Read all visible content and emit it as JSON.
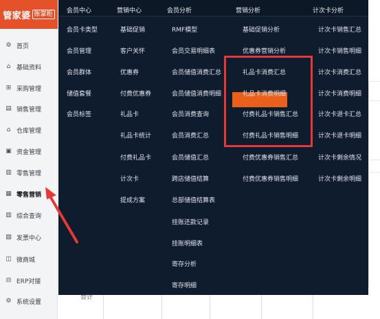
{
  "logo": {
    "main": "管家婆",
    "sub": "账掌柜"
  },
  "sidebar": {
    "items": [
      {
        "label": "首页",
        "icon": "gear-icon"
      },
      {
        "label": "基础资料",
        "icon": "home-icon"
      },
      {
        "label": "采购管理",
        "icon": "cart-icon"
      },
      {
        "label": "销售管理",
        "icon": "calendar-icon"
      },
      {
        "label": "仓库管理",
        "icon": "warehouse-icon"
      },
      {
        "label": "资金管理",
        "icon": "money-icon"
      },
      {
        "label": "零售管理",
        "icon": "chart-icon"
      },
      {
        "label": "零售营销",
        "icon": "shop-icon"
      },
      {
        "label": "综合查询",
        "icon": "bar-chart-icon"
      },
      {
        "label": "发票中心",
        "icon": "invoice-icon"
      },
      {
        "label": "微商城",
        "icon": "store-icon"
      },
      {
        "label": "ERP对接",
        "icon": "link-icon"
      },
      {
        "label": "系统设置",
        "icon": "settings-icon"
      }
    ],
    "active": "零售营销"
  },
  "mega_menu": {
    "columns": [
      {
        "head": "会员中心",
        "items": [
          "会员卡类型",
          "会员管理",
          "会员群体",
          "储值套餐",
          "会员标签"
        ]
      },
      {
        "head": "营销中心",
        "items": [
          "基础促销",
          "客户关怀",
          "优惠券",
          "付费优惠券",
          "礼品卡",
          "礼品卡统计",
          "付费礼品卡",
          "计次卡",
          "提成方案"
        ]
      },
      {
        "head": "会员分析",
        "items": [
          "RMF模型",
          "会员交易明细表",
          "会员储值消费汇总",
          "会员储值消费明细",
          "会员消费查询",
          "会员消费汇总",
          "会员储值汇总",
          "跨店储值结算",
          "总部储值结算表",
          "挂账还款记录",
          "挂账明细表",
          "寄存分析",
          "寄存明细"
        ]
      },
      {
        "head": "营销分析",
        "items": [
          "基础促销分析",
          "优惠券营销分析",
          "礼品卡消费汇总",
          "礼品卡消费明细",
          "付费礼品卡销售汇总",
          "付费礼品卡销售明细",
          "付费优惠券销售汇总",
          "付费优惠券销售明细"
        ]
      },
      {
        "head": "计次卡分析",
        "items": [
          "计次卡销售汇总",
          "计次卡销售明细",
          "计次卡消费汇总",
          "计次卡消费明细",
          "计次卡退卡汇总",
          "计次卡退卡明细",
          "计次卡剩余情况",
          "计次卡剩余明细"
        ]
      }
    ],
    "highlighted": "礼品卡消费明细"
  },
  "background": {
    "cell_text": "合计"
  },
  "colors": {
    "menu_bg": "#0f1c2d",
    "highlight": "#e8601c",
    "frame": "#e53935",
    "logo_bg": "#e5512a"
  }
}
